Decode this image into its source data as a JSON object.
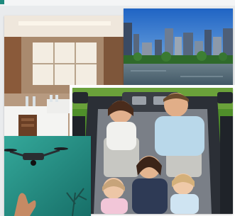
{
  "collage": {
    "description_free": true,
    "photos": [
      {
        "id": "restaurant",
        "subject": "restaurant-interior"
      },
      {
        "id": "city",
        "subject": "city-skyline-river"
      },
      {
        "id": "family",
        "subject": "family-in-convertible-car"
      },
      {
        "id": "drone",
        "subject": "drone-flying"
      }
    ]
  },
  "colors": {
    "accent_teal": "#1f8a7e",
    "sky_blue": "#2a6fc2",
    "car_dark": "#2b2f36",
    "grass_green": "#4f8f2a"
  }
}
